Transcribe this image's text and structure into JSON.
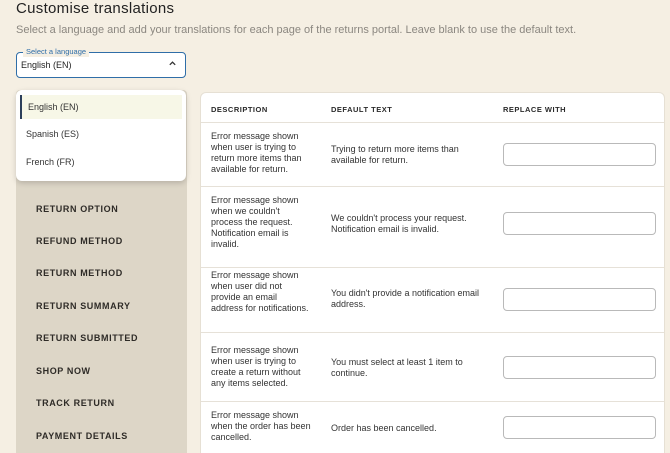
{
  "header": {
    "title": "Customise translations",
    "subtitle": "Select a language and add your translations for each page of the returns portal. Leave blank to use the default text."
  },
  "language_select": {
    "legend": "Select a language",
    "value": "English (EN)",
    "chevron_icon": "chevron-up-icon"
  },
  "dropdown": {
    "options": [
      "English (EN)",
      "Spanish (ES)",
      "French (FR)"
    ],
    "selected": "English (EN)"
  },
  "sidenav": {
    "items": [
      "RETURN OPTION",
      "REFUND METHOD",
      "RETURN METHOD",
      "RETURN SUMMARY",
      "RETURN SUBMITTED",
      "SHOP NOW",
      "TRACK RETURN",
      "PAYMENT DETAILS"
    ]
  },
  "table": {
    "headers": {
      "description": "DESCRIPTION",
      "default_text": "DEFAULT TEXT",
      "replace_with": "REPLACE WITH"
    },
    "rows": [
      {
        "description": "Error message shown when user is trying to return more items than available for return.",
        "default_text": "Trying to return more items than available for return.",
        "replace_with": ""
      },
      {
        "description": "Error message shown when we couldn't process the request. Notification email is invalid.",
        "default_text": "We couldn't process your request. Notification email is invalid.",
        "replace_with": ""
      },
      {
        "description": "Error message shown when user did not provide an email address for notifications.",
        "default_text": "You didn't provide a notification email address.",
        "replace_with": ""
      },
      {
        "description": "Error message shown when user is trying to create a return without any items selected.",
        "default_text": "You must select at least 1 item to continue.",
        "replace_with": ""
      },
      {
        "description": "Error message shown when the order has been cancelled.",
        "default_text": "Order has been cancelled.",
        "replace_with": ""
      }
    ]
  },
  "colors": {
    "background": "#f5efe3",
    "sidenav": "#ddd6c7",
    "accent": "#2f6ea8"
  }
}
